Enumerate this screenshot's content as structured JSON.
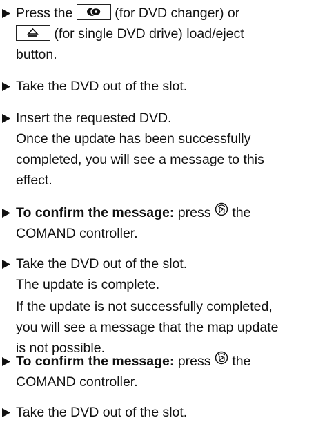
{
  "steps": [
    {
      "parts": {
        "a": "Press the",
        "b": "(for DVD changer) or",
        "c": "(for single DVD drive) load/eject",
        "d": "button."
      }
    },
    {
      "text": "Take the DVD out of the slot."
    },
    {
      "text": "Insert the requested DVD.",
      "result_lines": [
        "Once the update has been successfully",
        "completed, you will see a message to this",
        "effect."
      ]
    },
    {
      "bold": "To confirm the message:",
      "text_after": "press",
      "text_end": "the",
      "line2": "COMAND controller."
    },
    {
      "text": "Take the DVD out of the slot.",
      "result_lines": [
        "The update is complete."
      ],
      "note_lines": [
        "If the update is not successfully completed,",
        "you will see a message that the map update",
        "is not possible."
      ]
    },
    {
      "bold": "To confirm the message:",
      "text_after": "press",
      "text_end": "the",
      "line2": "COMAND controller."
    },
    {
      "text": "Take the DVD out of the slot."
    }
  ],
  "icons": {
    "bullet": "triangle-bullet-icon",
    "dvd_changer_button": "dvd-changer-load-eject-icon",
    "single_drive_button": "eject-icon",
    "controller_press": "controller-press-icon"
  }
}
